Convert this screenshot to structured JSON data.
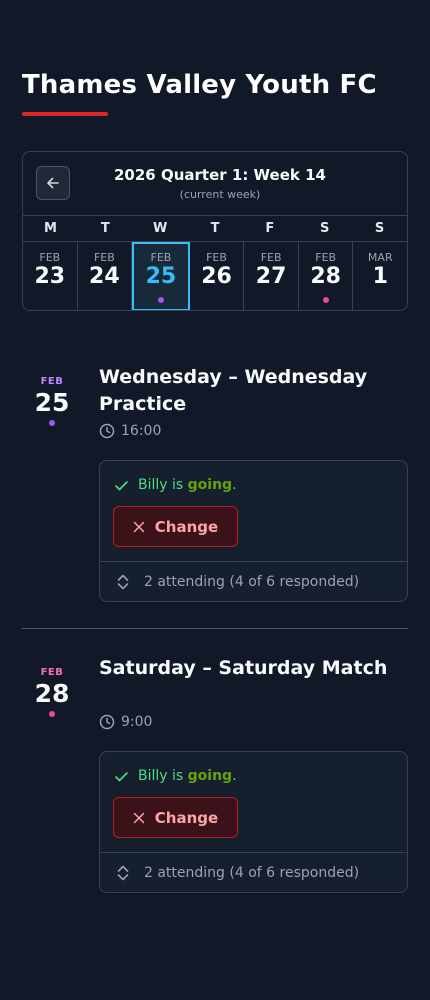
{
  "club": {
    "title": "Thames Valley Youth FC"
  },
  "calendar": {
    "week_title": "2026 Quarter 1: Week 14",
    "week_subtitle": "(current week)",
    "weekdays": [
      "M",
      "T",
      "W",
      "T",
      "F",
      "S",
      "S"
    ],
    "days": [
      {
        "month": "FEB",
        "day": "23",
        "current": false,
        "dot": null
      },
      {
        "month": "FEB",
        "day": "24",
        "current": false,
        "dot": null
      },
      {
        "month": "FEB",
        "day": "25",
        "current": true,
        "dot": "#a855f7"
      },
      {
        "month": "FEB",
        "day": "26",
        "current": false,
        "dot": null
      },
      {
        "month": "FEB",
        "day": "27",
        "current": false,
        "dot": null
      },
      {
        "month": "FEB",
        "day": "28",
        "current": false,
        "dot": "#ec4899"
      },
      {
        "month": "MAR",
        "day": "1",
        "current": false,
        "dot": null
      }
    ]
  },
  "events": [
    {
      "month": "FEB",
      "day": "25",
      "accent": "#a855f7",
      "month_color": "#c084fc",
      "title": "Wednesday – Wednesday Practice",
      "time": "16:00",
      "rsvp_prefix": "Billy is ",
      "rsvp_status": "going",
      "rsvp_suffix": ".",
      "change_label": "Change",
      "attending": "2 attending (4 of 6 responded)"
    },
    {
      "month": "FEB",
      "day": "28",
      "accent": "#ec4899",
      "month_color": "#f472b6",
      "title": "Saturday – Saturday Match",
      "time": "9:00",
      "rsvp_prefix": "Billy is ",
      "rsvp_status": "going",
      "rsvp_suffix": ".",
      "change_label": "Change",
      "attending": "2 attending (4 of 6 responded)"
    }
  ],
  "icons": {
    "back": "arrow-left-icon",
    "clock": "clock-icon",
    "check": "check-icon",
    "close": "x-icon",
    "expand": "chevron-up-down-icon"
  }
}
